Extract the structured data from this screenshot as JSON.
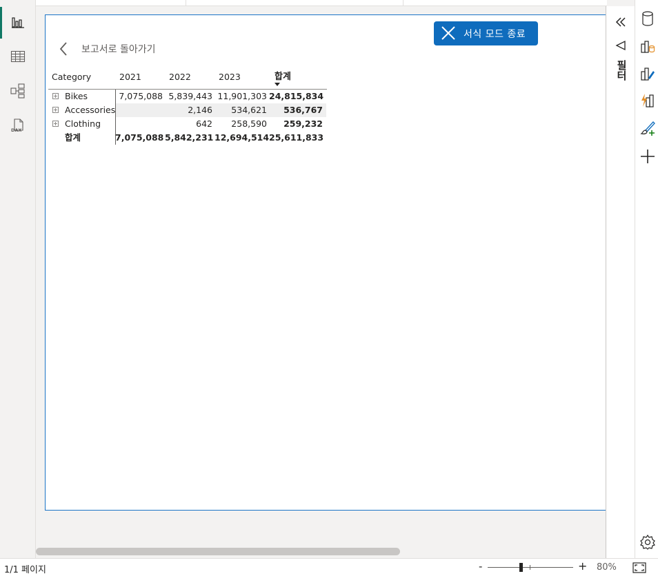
{
  "app": {
    "top_tabs": [
      "",
      ""
    ]
  },
  "left_rail": {
    "items": [
      {
        "name": "report-view",
        "icon": "bar-chart-icon",
        "active": true
      },
      {
        "name": "table-view",
        "icon": "table-grid-icon"
      },
      {
        "name": "model-view",
        "icon": "model-diagram-icon"
      },
      {
        "name": "dax-query-view",
        "icon": "dax-icon",
        "icon_text": "DAX"
      }
    ]
  },
  "focus_mode": {
    "exit_label": "서식 모드 종료"
  },
  "back_link": {
    "label": "보고서로 돌아가기"
  },
  "matrix": {
    "headers": [
      "Category",
      "2021",
      "2022",
      "2023",
      "합계"
    ],
    "rows": [
      {
        "label": "Bikes",
        "values": [
          "7,075,088",
          "5,839,443",
          "11,901,303"
        ],
        "total": "24,815,834"
      },
      {
        "label": "Accessories",
        "values": [
          "",
          "2,146",
          "534,621"
        ],
        "total": "536,767"
      },
      {
        "label": "Clothing",
        "values": [
          "",
          "642",
          "258,590"
        ],
        "total": "259,232"
      }
    ],
    "grand_total": {
      "label": "합계",
      "values": [
        "7,075,088",
        "5,842,231",
        "12,694,514"
      ],
      "total": "25,611,833"
    }
  },
  "collapsed_pane": {
    "label": "필터",
    "icons": [
      "double-chevron-left-icon",
      "megaphone-icon"
    ]
  },
  "right_rail": {
    "icons": [
      "data-cylinder-icon",
      "build-visual-icon",
      "format-visual-icon",
      "analytics-icon",
      "brush-add-icon",
      "plus-icon",
      "settings-gear-icon"
    ]
  },
  "status": {
    "page_indicator": "1/1 페이지",
    "zoom_minus": "-",
    "zoom_plus": "+",
    "zoom": "80%",
    "zoom_level": 0.8
  },
  "colors": {
    "accent": "#117865",
    "focus_button": "#0f6cbd",
    "page_border": "#1a73c6"
  }
}
